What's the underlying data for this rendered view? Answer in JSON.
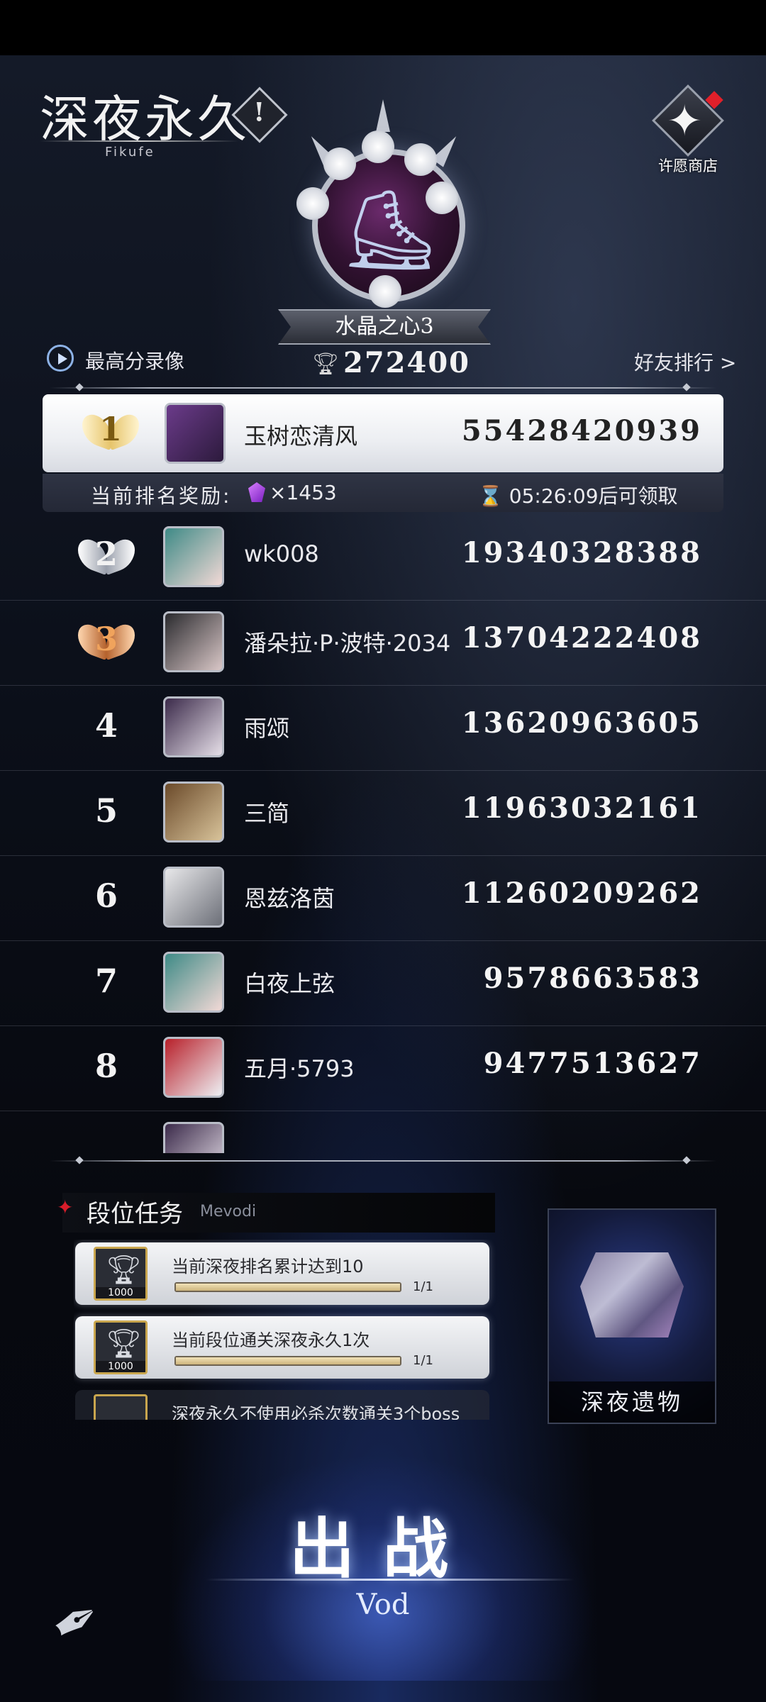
{
  "header": {
    "logo_title": "深夜永久",
    "logo_subtitle": "Fikufe",
    "shop_label": "许愿商店",
    "rank_tier": "水晶之心3",
    "best_record_label": "最高分录像",
    "best_score": "272400",
    "friends_label": "好友排行 >"
  },
  "rankings": [
    {
      "rank": "1",
      "name": "玉树恋清风",
      "score": "55428420939"
    },
    {
      "rank": "2",
      "name": "wk008",
      "score": "19340328388"
    },
    {
      "rank": "3",
      "name": "潘朵拉·P·波特·2034",
      "score": "13704222408"
    },
    {
      "rank": "4",
      "name": "雨颂",
      "score": "13620963605"
    },
    {
      "rank": "5",
      "name": "三简",
      "score": "11963032161"
    },
    {
      "rank": "6",
      "name": "恩兹洛茵",
      "score": "11260209262"
    },
    {
      "rank": "7",
      "name": "白夜上弦",
      "score": "9578663583"
    },
    {
      "rank": "8",
      "name": "五月·5793",
      "score": "9477513627"
    }
  ],
  "reward": {
    "label": "当前排名奖励:",
    "count": "×1453",
    "timer": "05:26:09后可领取"
  },
  "tasks_panel": {
    "title": "段位任务",
    "subtitle": "Mevodi",
    "items": [
      {
        "text": "当前深夜排名累计达到10",
        "icon_value": "1000",
        "progress": "1/1",
        "progress_fraction": 1.0
      },
      {
        "text": "当前段位通关深夜永久1次",
        "icon_value": "1000",
        "progress": "1/1",
        "progress_fraction": 1.0
      },
      {
        "text": "深夜永久不使用必杀次数通关3个boss"
      }
    ]
  },
  "relic": {
    "label": "深夜遗物"
  },
  "battle": {
    "label": "出战",
    "sub": "Vod"
  },
  "colors": {
    "accent_red": "#d81d2a",
    "gold_medal": "#e6c46b",
    "silver_medal": "#c9ccd4",
    "bronze_medal": "#d98a4a",
    "battle_glow": "#5a82ff"
  }
}
